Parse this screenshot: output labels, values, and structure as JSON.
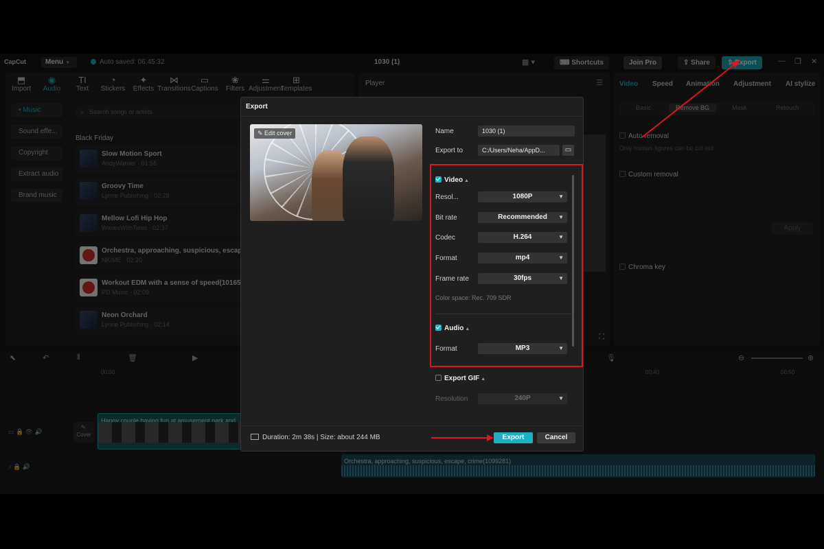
{
  "titlebar": {
    "logo": "CapCut",
    "menu": "Menu",
    "autosave": "Auto saved: 06:45:32",
    "project": "1030 (1)",
    "shortcuts": "Shortcuts",
    "join_pro": "Join Pro",
    "share": "Share",
    "export": "Export"
  },
  "left_tabs": [
    {
      "icon": "import-icon",
      "glyph": "⬒",
      "label": "Import"
    },
    {
      "icon": "audio-icon",
      "glyph": "◉",
      "label": "Audio"
    },
    {
      "icon": "text-icon",
      "glyph": "TI",
      "label": "Text"
    },
    {
      "icon": "stickers-icon",
      "glyph": "◔",
      "label": "Stickers"
    },
    {
      "icon": "effects-icon",
      "glyph": "✦",
      "label": "Effects"
    },
    {
      "icon": "transitions-icon",
      "glyph": "⋈",
      "label": "Transitions"
    },
    {
      "icon": "captions-icon",
      "glyph": "▭",
      "label": "Captions"
    },
    {
      "icon": "filters-icon",
      "glyph": "❀",
      "label": "Filters"
    },
    {
      "icon": "adjustment-icon",
      "glyph": "⚌",
      "label": "Adjustment"
    },
    {
      "icon": "templates-icon",
      "glyph": "⊞",
      "label": "Templates"
    }
  ],
  "side_menu": [
    "• Music",
    "Sound effe...",
    "Copyright",
    "Extract audio",
    "Brand music"
  ],
  "search_placeholder": "Search songs or artists",
  "section_label": "Black Friday",
  "tracks": [
    {
      "title": "Slow Motion Sport",
      "sub": "AndyWarner · 01:55",
      "thumb": "blue"
    },
    {
      "title": "Groovy Time",
      "sub": "Lynne Publishing · 02:28",
      "thumb": "blue"
    },
    {
      "title": "Mellow Lofi Hip Hop",
      "sub": "WavesWithTales · 02:37",
      "thumb": "blue"
    },
    {
      "title": "Orchestra, approaching, suspicious, escape",
      "sub": "NKIME · 02:20",
      "thumb": "red"
    },
    {
      "title": "Workout EDM with a sense of speed(10165",
      "sub": "PD Music · 02:09",
      "thumb": "red"
    },
    {
      "title": "Neon Orchard",
      "sub": "Lynne Publishing · 02:14",
      "thumb": "blue"
    }
  ],
  "player": {
    "title": "Player"
  },
  "right_tabs": [
    "Video",
    "Speed",
    "Animation",
    "Adjustment",
    "AI stylize"
  ],
  "right_subtabs": [
    "Basic",
    "Remove BG",
    "Mask",
    "Retouch"
  ],
  "right": {
    "auto_removal": "Auto removal",
    "auto_removal_hint": "Only human figures can be cut out.",
    "custom_removal": "Custom removal",
    "apply": "Apply",
    "chroma_key": "Chroma key"
  },
  "timeline": {
    "time_00": "00:00",
    "time_40": "00:40",
    "time_50": "00:50",
    "cover": "Cover",
    "video_clip": "Happy couple having fun at amusement park and",
    "audio_clip": "Orchestra, approaching, suspicious, escape, crime(1099281)"
  },
  "dialog": {
    "title": "Export",
    "edit_cover": "Edit cover",
    "name_label": "Name",
    "name_value": "1030 (1)",
    "export_to_label": "Export to",
    "export_to_value": "C:/Users/Neha/AppD...",
    "video_section": "Video",
    "resolution_label": "Resol...",
    "resolution_value": "1080P",
    "bitrate_label": "Bit rate",
    "bitrate_value": "Recommended",
    "codec_label": "Codec",
    "codec_value": "H.264",
    "format_label": "Format",
    "format_value": "mp4",
    "framerate_label": "Frame rate",
    "framerate_value": "30fps",
    "colorspace": "Color space: Rec. 709 SDR",
    "audio_section": "Audio",
    "audio_format_label": "Format",
    "audio_format_value": "MP3",
    "gif_section": "Export GIF",
    "gif_resolution_label": "Resolution",
    "gif_resolution_value": "240P",
    "duration": "Duration: 2m 38s | Size: about 244 MB",
    "export_button": "Export",
    "cancel_button": "Cancel"
  },
  "colors": {
    "accent": "#1eaebd",
    "annotation": "#e0141f",
    "background": "#181818"
  }
}
